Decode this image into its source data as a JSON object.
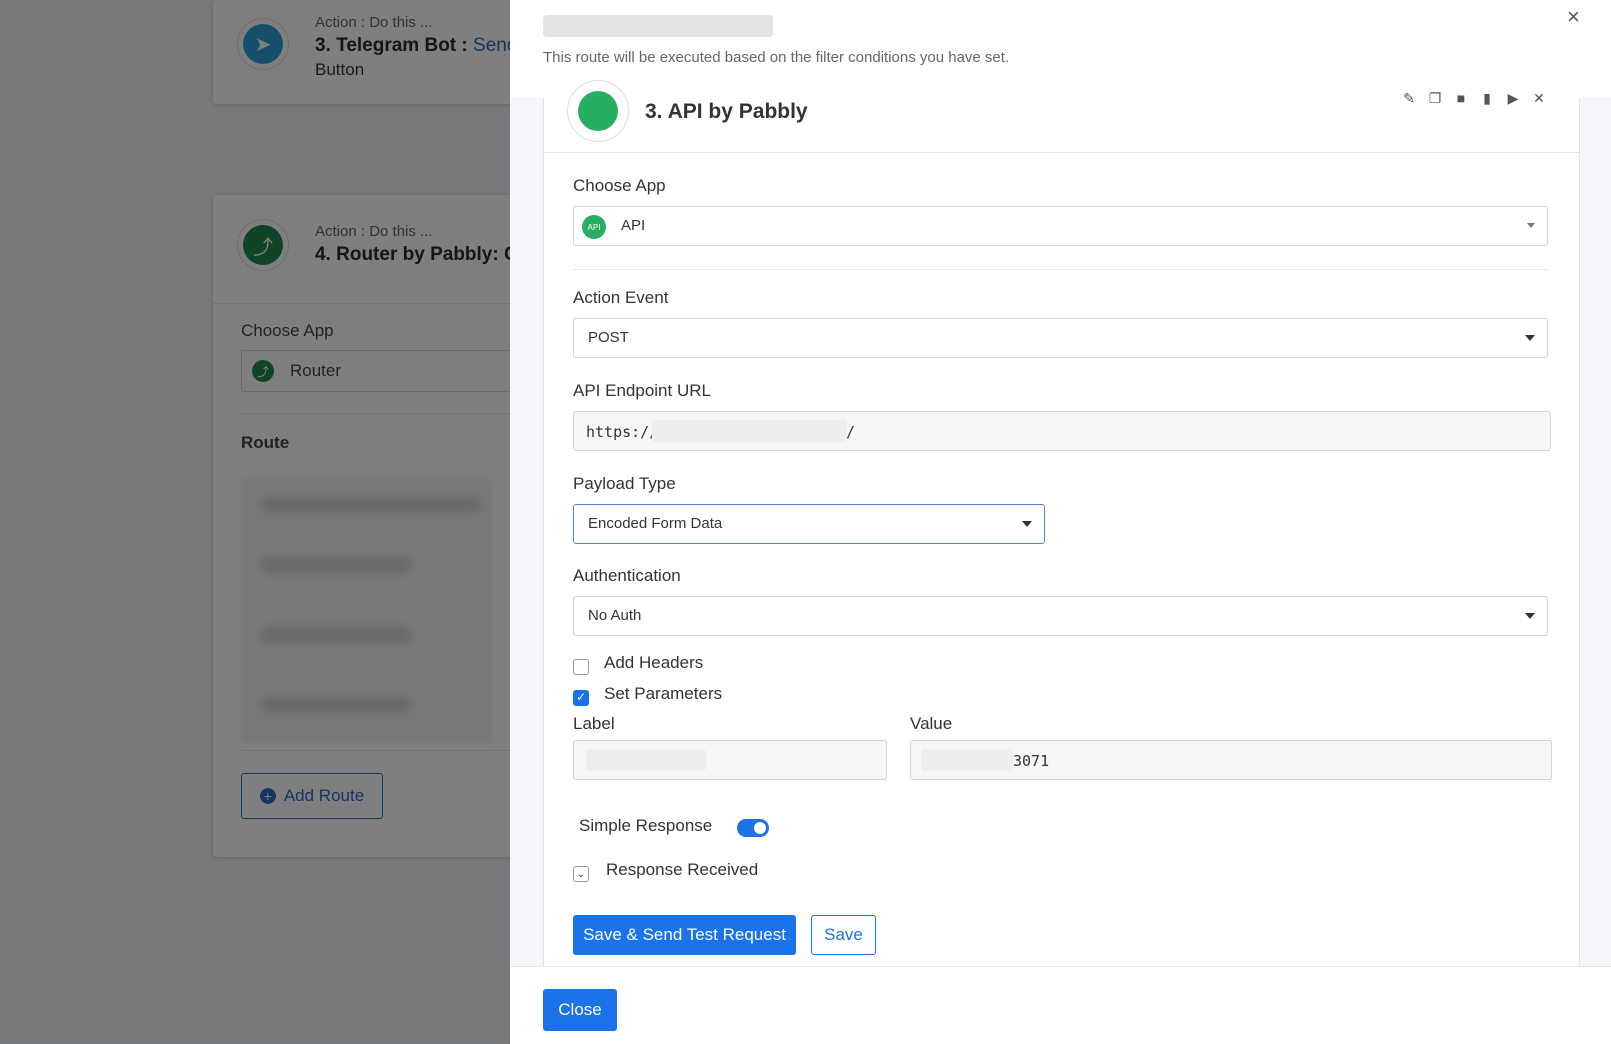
{
  "background": {
    "card1": {
      "action_small": "Action : Do this ...",
      "title": "3. Telegram Bot : ",
      "title_tail": "Send",
      "title_line2": "Button"
    },
    "card2": {
      "action_small": "Action : Do this ...",
      "title": "4. Router by Pabbly: C",
      "choose_app_label": "Choose App",
      "app_value": "Router",
      "route_label": "Route",
      "add_route_label": "Add Route"
    }
  },
  "panel": {
    "subtitle": "This route will be executed based on the filter conditions you have set.",
    "close_glyph": "×",
    "step_title": "3. API by Pabbly",
    "fields": {
      "choose_app": {
        "label": "Choose App",
        "value": "API"
      },
      "action_event": {
        "label": "Action Event",
        "value": "POST"
      },
      "endpoint": {
        "label": "API Endpoint URL",
        "prefix": "https://",
        "suffix": "/"
      },
      "payload_type": {
        "label": "Payload Type",
        "value": "Encoded Form Data"
      },
      "authentication": {
        "label": "Authentication",
        "value": "No Auth"
      }
    },
    "checkboxes": {
      "add_headers": {
        "label": "Add Headers",
        "checked": false
      },
      "set_parameters": {
        "label": "Set Parameters",
        "checked": true
      }
    },
    "parameters": {
      "label_header": "Label",
      "value_header": "Value",
      "value_suffix": "3071"
    },
    "simple_response_label": "Simple Response",
    "response_received_label": "Response Received",
    "buttons": {
      "save_send": "Save & Send Test Request",
      "save": "Save",
      "close": "Close"
    }
  }
}
